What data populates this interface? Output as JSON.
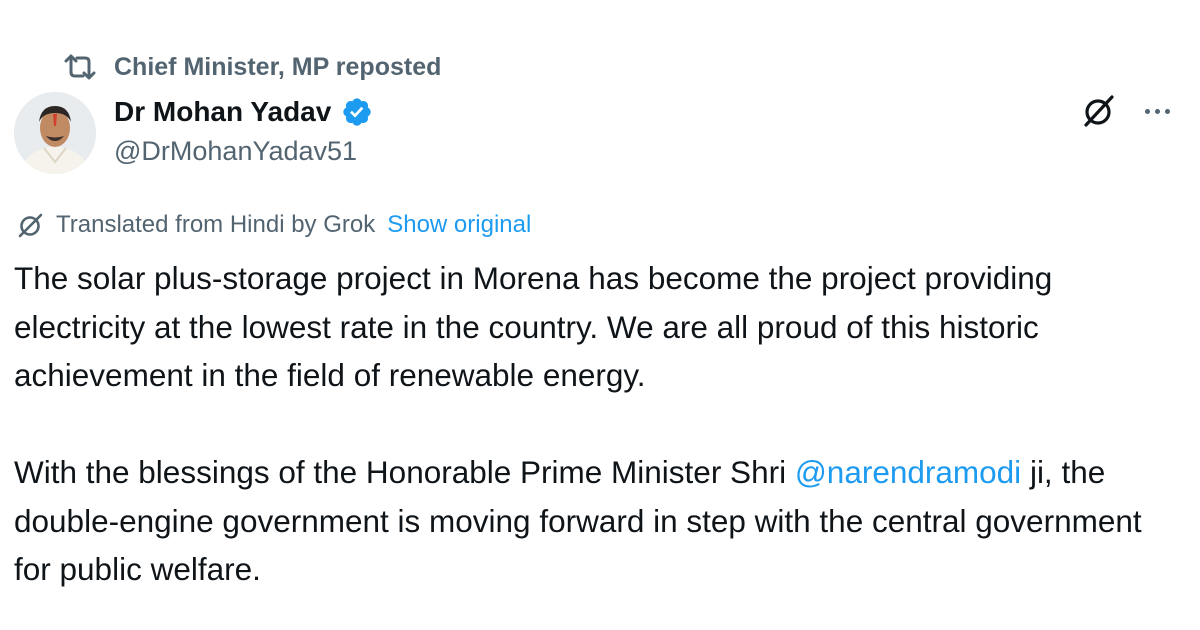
{
  "repost": {
    "label": "Chief Minister, MP reposted"
  },
  "author": {
    "display_name": "Dr Mohan Yadav",
    "handle": "@DrMohanYadav51",
    "verified": true
  },
  "translation": {
    "label": "Translated from Hindi by Grok",
    "show_original": "Show original"
  },
  "tweet": {
    "paragraph_1": "The solar plus-storage project in Morena has become the project providing electricity at the lowest rate in the country. We are all proud of this historic achievement in the field of renewable energy.",
    "paragraph_2_before": "With the blessings of the Honorable Prime Minister Shri ",
    "mention": "@narendramodi",
    "paragraph_2_after": " ji, the double-engine government is moving forward in step with the central government for public welfare."
  },
  "icons": {
    "repost": "repost-icon",
    "verified": "verified-badge-icon",
    "grok": "grok-icon",
    "more": "more-icon"
  },
  "colors": {
    "text_primary": "#0f1419",
    "text_secondary": "#536471",
    "link_blue": "#1d9bf0",
    "verified_blue": "#1d9bf0",
    "background": "#ffffff"
  }
}
